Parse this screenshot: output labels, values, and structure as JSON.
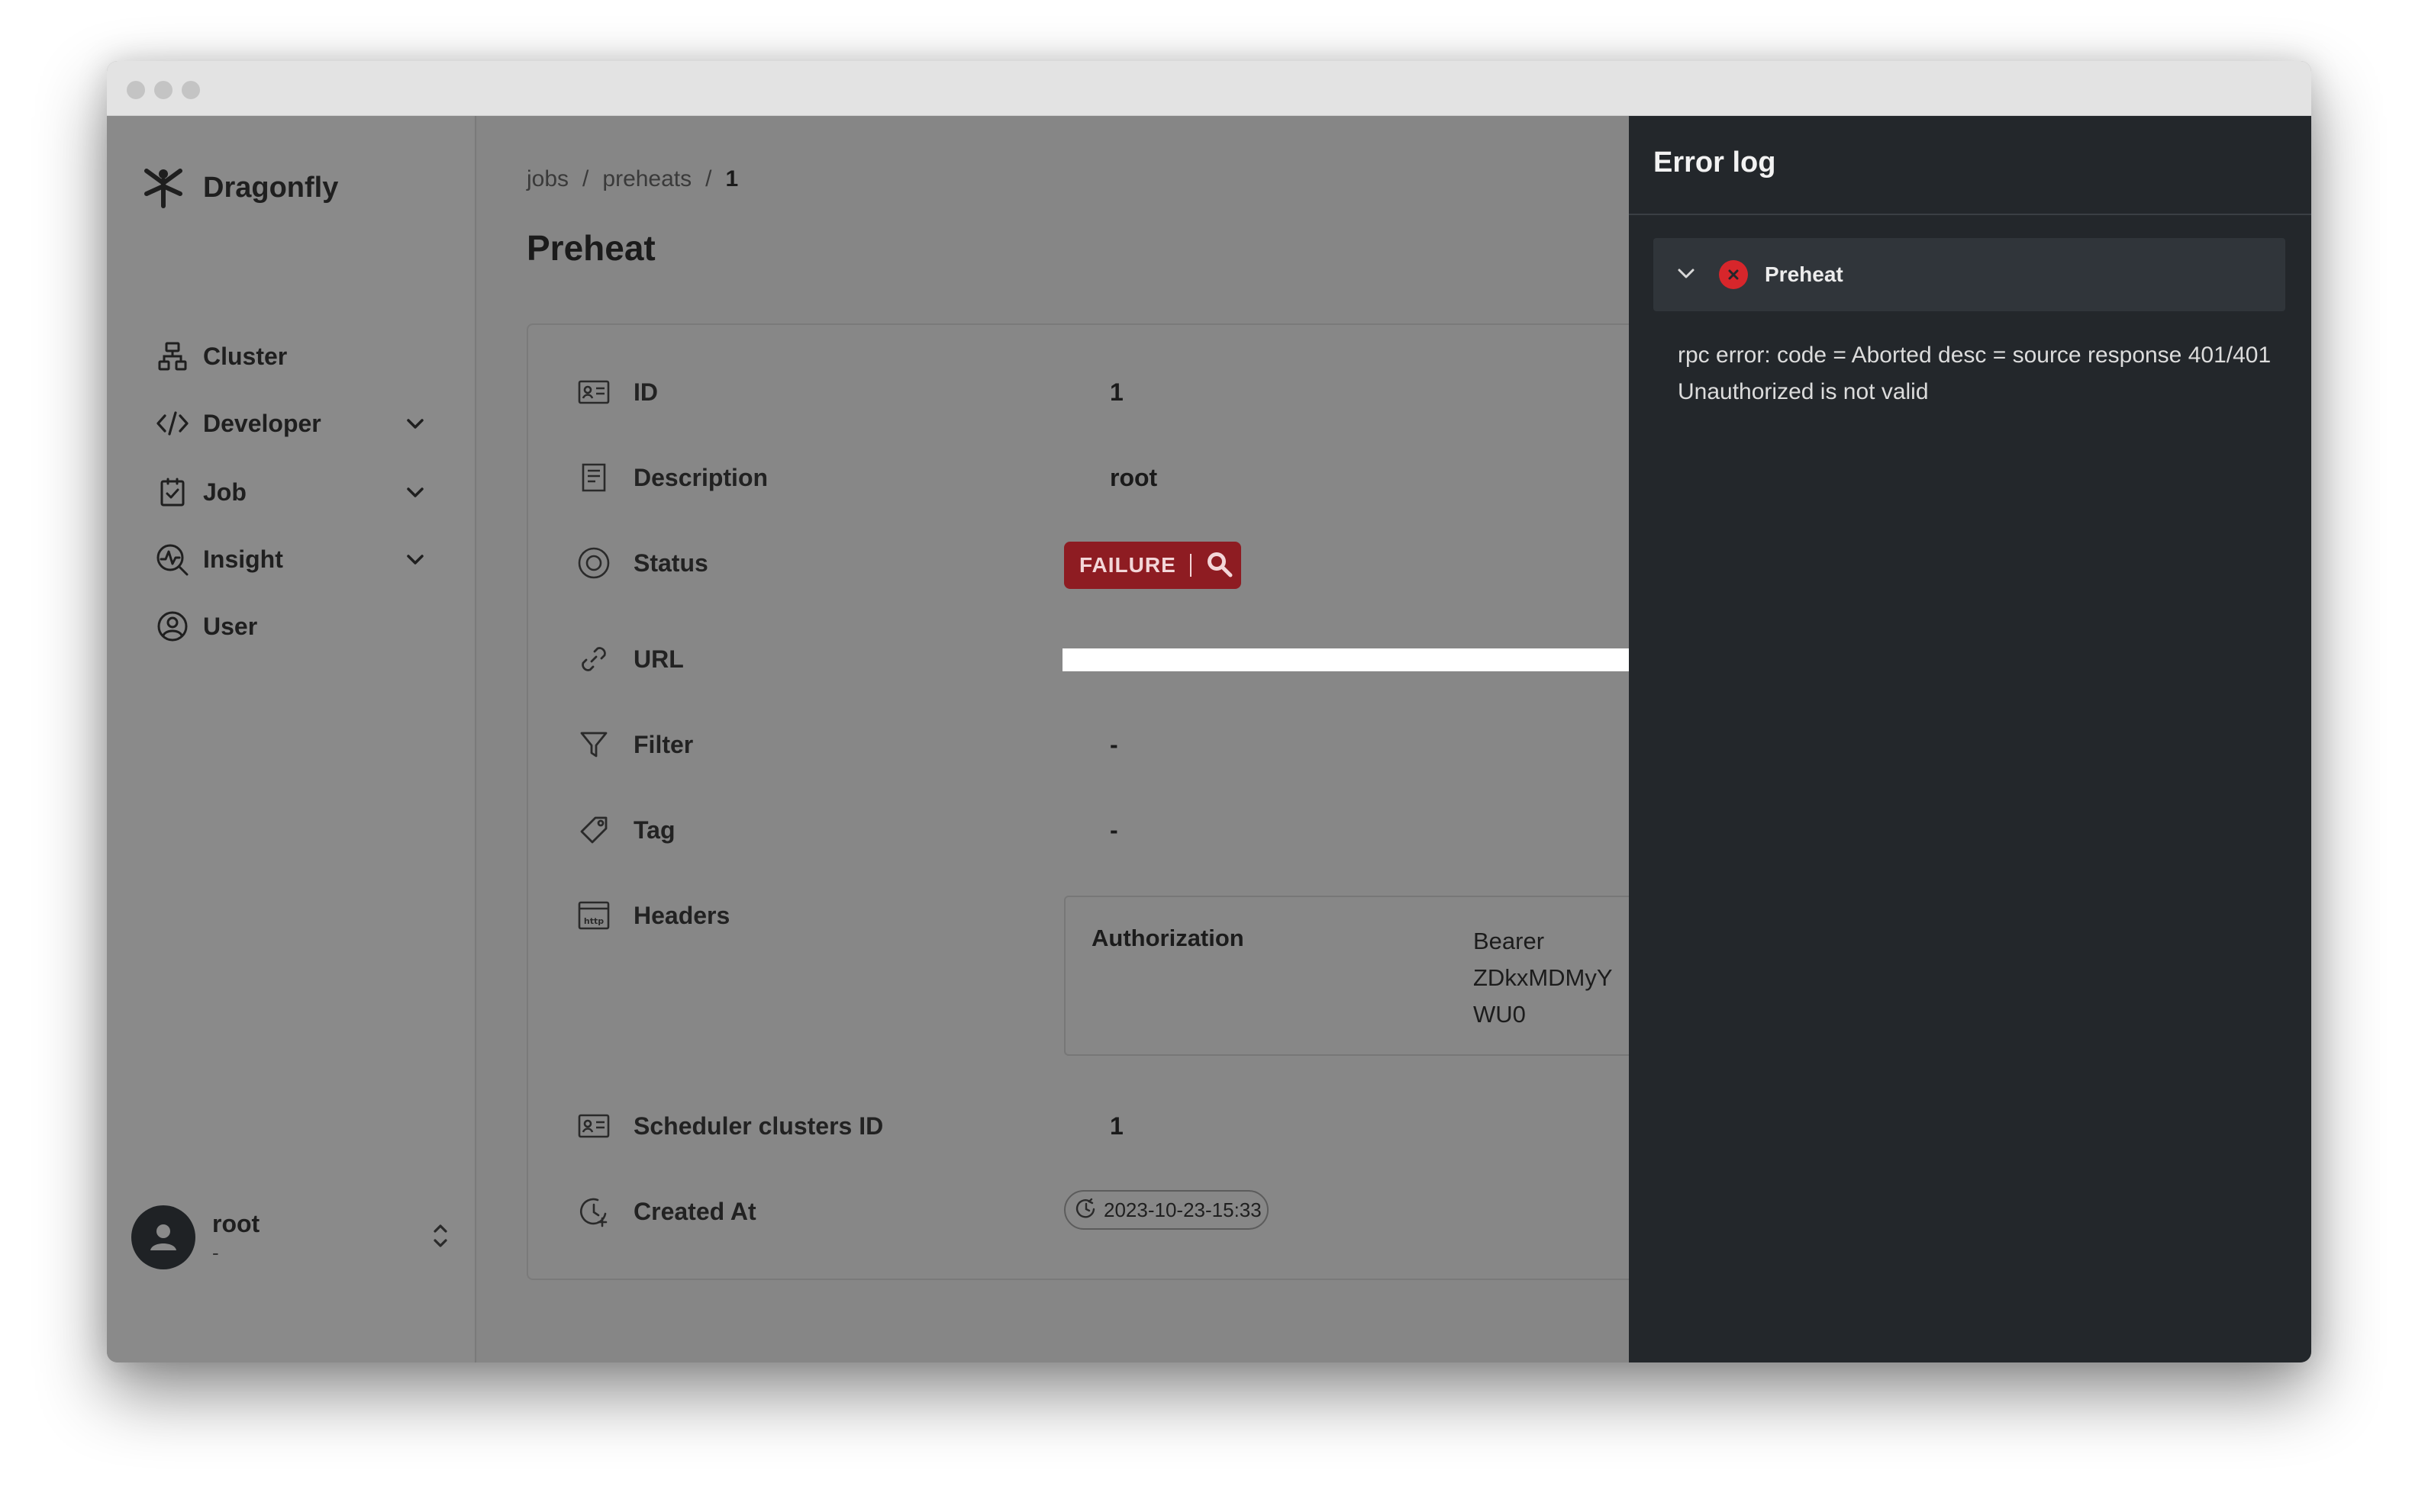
{
  "window": {
    "traffic_lights": 3
  },
  "sidebar": {
    "brand": "Dragonfly",
    "items": [
      {
        "label": "Cluster",
        "icon": "cluster-icon",
        "expandable": false
      },
      {
        "label": "Developer",
        "icon": "code-icon",
        "expandable": true
      },
      {
        "label": "Job",
        "icon": "job-icon",
        "expandable": true
      },
      {
        "label": "Insight",
        "icon": "insight-icon",
        "expandable": true
      },
      {
        "label": "User",
        "icon": "user-icon",
        "expandable": false
      }
    ],
    "user": {
      "name": "root",
      "sub": "-"
    }
  },
  "breadcrumb": [
    "jobs",
    "preheats",
    "1"
  ],
  "page_title": "Preheat",
  "details": {
    "id": {
      "label": "ID",
      "value": "1"
    },
    "description": {
      "label": "Description",
      "value": "root"
    },
    "status": {
      "label": "Status",
      "value": "FAILURE",
      "color": "#8e1c22"
    },
    "url": {
      "label": "URL",
      "value": ""
    },
    "filter": {
      "label": "Filter",
      "value": "-"
    },
    "tag": {
      "label": "Tag",
      "value": "-"
    },
    "headers": {
      "label": "Headers",
      "key": "Authorization",
      "value_lines": [
        "Bearer",
        "ZDkxMDMyY",
        "WU0"
      ]
    },
    "scheduler": {
      "label": "Scheduler clusters ID",
      "value": "1"
    },
    "created": {
      "label": "Created At",
      "value": "2023-10-23-15:33"
    }
  },
  "drawer": {
    "title": "Error log",
    "item_title": "Preheat",
    "message": "rpc error: code = Aborted desc = source response 401/401 Unauthorized is not valid",
    "error_color": "#d7262b"
  }
}
